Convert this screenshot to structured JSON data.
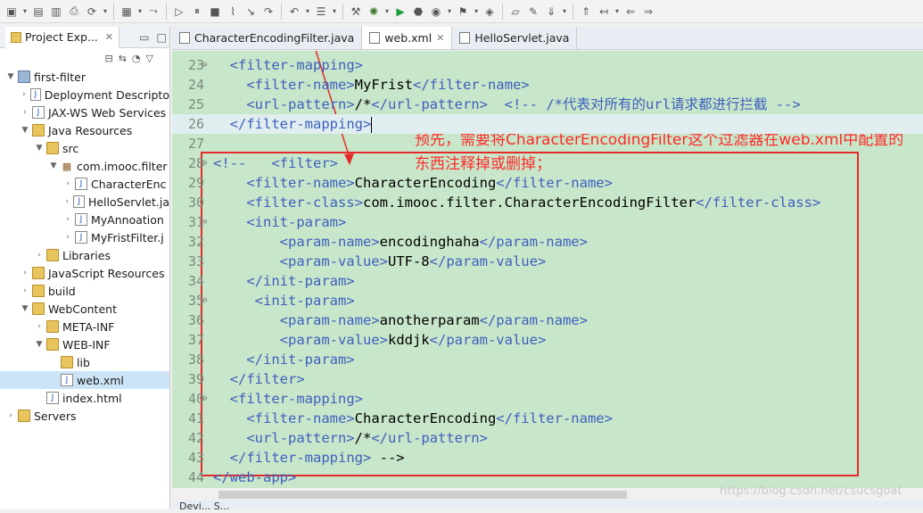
{
  "toolbar": {
    "icons": [
      "new-icon",
      "save-icon",
      "save-all-icon",
      "print-icon",
      "refresh-icon",
      "terminal-icon",
      "skip-icon",
      "resume-icon",
      "suspend-icon",
      "terminate-icon",
      "disconnect-icon",
      "step-into-icon",
      "step-over-icon",
      "step-return-icon",
      "task-icon",
      "build-icon",
      "debug-icon",
      "run-icon",
      "run-server-icon",
      "coverage-icon",
      "external-tools-icon",
      "open-type-icon",
      "open-folder-icon",
      "search-icon",
      "next-annotation-icon",
      "prev-annotation-icon",
      "last-edit-icon",
      "back-icon",
      "forward-icon"
    ]
  },
  "explorer": {
    "title": "Project Exp...",
    "close": "✕",
    "tree": [
      {
        "label": "first-filter",
        "indent": 0,
        "arrow": "▼",
        "icon": "project"
      },
      {
        "label": "Deployment Descripto",
        "indent": 1,
        "arrow": "›",
        "icon": "file"
      },
      {
        "label": "JAX-WS Web Services",
        "indent": 1,
        "arrow": "›",
        "icon": "file"
      },
      {
        "label": "Java Resources",
        "indent": 1,
        "arrow": "▼",
        "icon": "folder"
      },
      {
        "label": "src",
        "indent": 2,
        "arrow": "▼",
        "icon": "folder"
      },
      {
        "label": "com.imooc.filter",
        "indent": 3,
        "arrow": "▼",
        "icon": "package"
      },
      {
        "label": "CharacterEnc",
        "indent": 4,
        "arrow": "›",
        "icon": "file"
      },
      {
        "label": "HelloServlet.ja",
        "indent": 4,
        "arrow": "›",
        "icon": "file"
      },
      {
        "label": "MyAnnoation",
        "indent": 4,
        "arrow": "›",
        "icon": "file"
      },
      {
        "label": "MyFristFilter.j",
        "indent": 4,
        "arrow": "›",
        "icon": "file"
      },
      {
        "label": "Libraries",
        "indent": 2,
        "arrow": "›",
        "icon": "folder"
      },
      {
        "label": "JavaScript Resources",
        "indent": 1,
        "arrow": "›",
        "icon": "folder"
      },
      {
        "label": "build",
        "indent": 1,
        "arrow": "›",
        "icon": "folder"
      },
      {
        "label": "WebContent",
        "indent": 1,
        "arrow": "▼",
        "icon": "folder"
      },
      {
        "label": "META-INF",
        "indent": 2,
        "arrow": "›",
        "icon": "folder"
      },
      {
        "label": "WEB-INF",
        "indent": 2,
        "arrow": "▼",
        "icon": "folder"
      },
      {
        "label": "lib",
        "indent": 3,
        "arrow": "",
        "icon": "folder"
      },
      {
        "label": "web.xml",
        "indent": 3,
        "arrow": "",
        "icon": "file",
        "selected": true
      },
      {
        "label": "index.html",
        "indent": 2,
        "arrow": "",
        "icon": "file"
      },
      {
        "label": "Servers",
        "indent": 0,
        "arrow": "›",
        "icon": "folder"
      }
    ]
  },
  "editor": {
    "tabs": [
      {
        "label": "CharacterEncodingFilter.java",
        "active": false,
        "close": ""
      },
      {
        "label": "web.xml",
        "active": true,
        "close": "✕"
      },
      {
        "label": "HelloServlet.java",
        "active": false,
        "close": ""
      }
    ],
    "lines": [
      {
        "n": "23",
        "fold": "⊖",
        "text": "  <filter-mapping>"
      },
      {
        "n": "24",
        "fold": "",
        "text": "    <filter-name>MyFrist</filter-name>"
      },
      {
        "n": "25",
        "fold": "",
        "text": "    <url-pattern>/*</url-pattern>  <!-- /*代表对所有的url请求都进行拦截 -->"
      },
      {
        "n": "26",
        "fold": "",
        "text": "  </filter-mapping>",
        "current": true
      },
      {
        "n": "27",
        "fold": "",
        "text": ""
      },
      {
        "n": "28",
        "fold": "⊖",
        "text": "<!--   <filter>"
      },
      {
        "n": "29",
        "fold": "",
        "text": "    <filter-name>CharacterEncoding</filter-name>"
      },
      {
        "n": "30",
        "fold": "",
        "text": "    <filter-class>com.imooc.filter.CharacterEncodingFilter</filter-class>"
      },
      {
        "n": "31",
        "fold": "⊖",
        "text": "    <init-param>"
      },
      {
        "n": "32",
        "fold": "",
        "text": "        <param-name>encodinghaha</param-name>"
      },
      {
        "n": "33",
        "fold": "",
        "text": "        <param-value>UTF-8</param-value>"
      },
      {
        "n": "34",
        "fold": "",
        "text": "    </init-param>"
      },
      {
        "n": "35",
        "fold": "⊖",
        "text": "     <init-param>"
      },
      {
        "n": "36",
        "fold": "",
        "text": "        <param-name>anotherparam</param-name>"
      },
      {
        "n": "37",
        "fold": "",
        "text": "        <param-value>kddjk</param-value>"
      },
      {
        "n": "38",
        "fold": "",
        "text": "    </init-param>"
      },
      {
        "n": "39",
        "fold": "",
        "text": "  </filter>"
      },
      {
        "n": "40",
        "fold": "⊖",
        "text": "  <filter-mapping>"
      },
      {
        "n": "41",
        "fold": "",
        "text": "    <filter-name>CharacterEncoding</filter-name>"
      },
      {
        "n": "42",
        "fold": "",
        "text": "    <url-pattern>/*</url-pattern>"
      },
      {
        "n": "43",
        "fold": "",
        "text": "  </filter-mapping> -->"
      },
      {
        "n": "44",
        "fold": "",
        "text": "</web-app>"
      }
    ],
    "annotation": "预先，需要将CharacterEncodingFilter这个过滤器在web.xml中配置的东西注释掉或删掉；"
  },
  "bottom_tab": "Devi... S...",
  "watermark": "https://blog.csdn.net/csucsgoat",
  "colors": {
    "editor_bg": "#c8e6c9",
    "tag": "#2a5fa3",
    "annotation": "#ff2a2a"
  }
}
